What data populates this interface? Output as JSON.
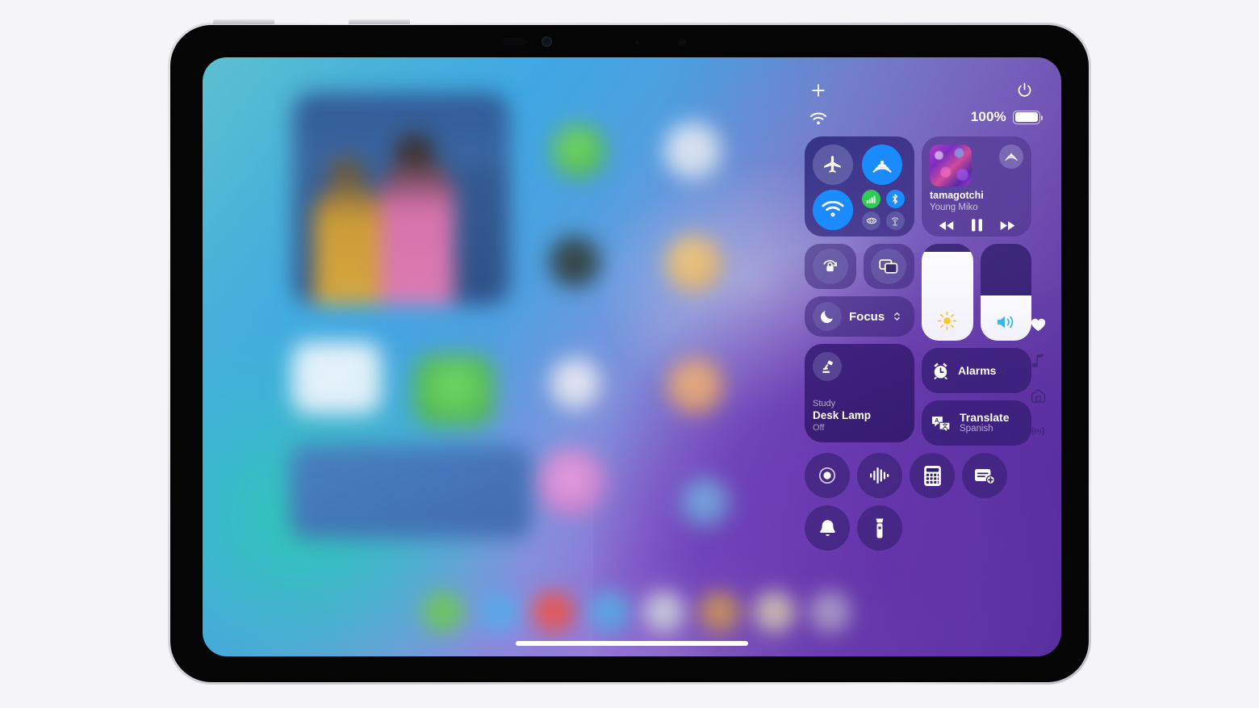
{
  "device": {
    "name": "iPad",
    "frame_color": "#d8d8dc",
    "buttons": [
      "volume-up",
      "volume-down"
    ]
  },
  "status_bar": {
    "add_controls_label": "+",
    "power_icon": "power-icon",
    "wifi_icon": "wifi-icon",
    "battery_percent": "100%",
    "battery_level": 100
  },
  "connectivity": {
    "airplane_mode": {
      "label": "Airplane Mode",
      "icon": "airplane-icon",
      "active": false
    },
    "airdrop": {
      "label": "AirDrop",
      "icon": "airdrop-icon",
      "active": true,
      "color": "#1b8cff"
    },
    "wifi": {
      "label": "Wi-Fi",
      "icon": "wifi-icon",
      "active": true,
      "color": "#1b8cff"
    },
    "cellular": {
      "label": "Cellular Data",
      "icon": "cellular-bars-icon",
      "active": true,
      "color": "#2ecc54"
    },
    "bluetooth": {
      "label": "Bluetooth",
      "icon": "bluetooth-icon",
      "active": true,
      "color": "#1b8cff"
    },
    "vpn": {
      "label": "VPN",
      "icon": "vpn-icon",
      "active": false
    },
    "hotspot": {
      "label": "Personal Hotspot",
      "icon": "personal-hotspot-icon",
      "active": false
    }
  },
  "now_playing": {
    "title": "tamagotchi",
    "artist": "Young Miko",
    "artwork": "album-artwork",
    "airplay_icon": "airplay-icon",
    "rewind_icon": "rewind-icon",
    "play_pause_icon": "pause-icon",
    "forward_icon": "fast-forward-icon",
    "state": "playing"
  },
  "display_controls": {
    "rotation_lock": {
      "label": "Rotation Lock",
      "icon": "rotation-lock-icon",
      "active": false
    },
    "screen_mirroring": {
      "label": "Screen Mirroring",
      "icon": "screen-mirroring-icon",
      "active": false
    },
    "focus": {
      "label": "Focus",
      "icon": "moon-icon",
      "chevron": "chevron-up-down-icon"
    }
  },
  "sliders": {
    "brightness": {
      "label": "Brightness",
      "icon": "brightness-sun-icon",
      "value": 92,
      "icon_color": "#ffc429"
    },
    "volume": {
      "label": "Volume",
      "icon": "speaker-wave-icon",
      "value": 47,
      "icon_color": "#3ab7e8"
    }
  },
  "home_accessory": {
    "room": "Study",
    "name": "Desk Lamp",
    "state": "Off",
    "icon": "desk-lamp-icon"
  },
  "shortcuts": [
    {
      "label": "Alarms",
      "sublabel": "",
      "icon": "alarm-clock-icon"
    },
    {
      "label": "Translate",
      "sublabel": "Spanish",
      "icon": "translate-icon"
    }
  ],
  "utilities": [
    {
      "label": "Screen Recording",
      "icon": "screen-record-icon"
    },
    {
      "label": "Voice Memo",
      "icon": "voice-memo-icon"
    },
    {
      "label": "Calculator",
      "icon": "calculator-icon"
    },
    {
      "label": "New Note",
      "icon": "new-note-icon"
    },
    {
      "label": "Ringer",
      "icon": "bell-icon"
    },
    {
      "label": "Flashlight",
      "icon": "flashlight-icon"
    }
  ],
  "pages": [
    {
      "label": "Favorites",
      "icon": "heart-icon",
      "active": true
    },
    {
      "label": "Now Playing",
      "icon": "music-note-icon",
      "active": false
    },
    {
      "label": "Home",
      "icon": "home-icon",
      "active": false
    },
    {
      "label": "Connectivity",
      "icon": "connectivity-icon",
      "active": false
    }
  ],
  "home_screen": {
    "home_indicator": "home-indicator",
    "dock_icon_colors": [
      "#6ec265",
      "#5ba8e8",
      "#e85a5a",
      "#5fb0e8",
      "#d8dbe6",
      "#dca45e",
      "#efe2c4",
      "#cfc2e4"
    ]
  }
}
